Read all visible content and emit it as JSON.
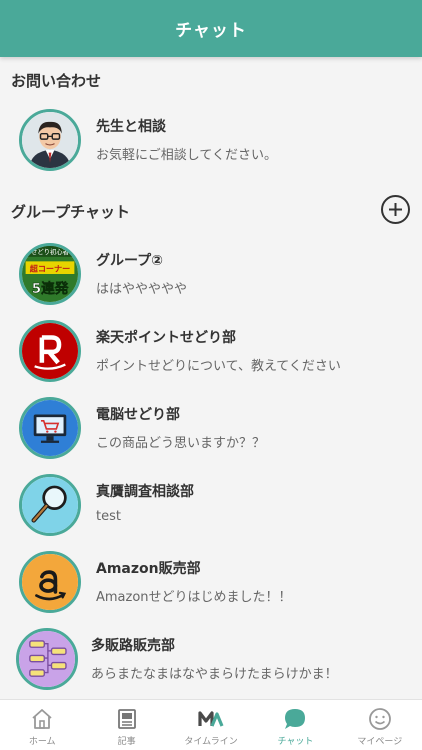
{
  "header": {
    "title": "チャット"
  },
  "inquiry": {
    "section_title": "お問い合わせ",
    "item": {
      "title": "先生と相談",
      "subtitle": "お気軽にご相談してください。"
    }
  },
  "groups": {
    "section_title": "グループチャット",
    "add_icon": "plus-circle-icon",
    "items": [
      {
        "title": "グループ②",
        "subtitle": "ははややややや",
        "avatar_text_top": "せどり初心者",
        "avatar_text_mid": "超コーナー",
        "avatar_text_bottom": "5連発"
      },
      {
        "title": "楽天ポイントせどり部",
        "subtitle": "ポイントせどりについて、教えてください"
      },
      {
        "title": "電脳せどり部",
        "subtitle": "この商品どう思いますか？？"
      },
      {
        "title": "真贋調査相談部",
        "subtitle": "test"
      },
      {
        "title": "Amazon販売部",
        "subtitle": "Amazonせどりはじめました！！"
      },
      {
        "title": "多販路販売部",
        "subtitle": "あらまたなまはなやまらけたまらけかま！"
      }
    ]
  },
  "tabbar": {
    "items": [
      {
        "label": "ホーム",
        "icon": "home-icon"
      },
      {
        "label": "記事",
        "icon": "article-icon"
      },
      {
        "label": "タイムライン",
        "icon": "timeline-icon"
      },
      {
        "label": "チャット",
        "icon": "chat-icon",
        "active": true
      },
      {
        "label": "マイページ",
        "icon": "mypage-icon"
      }
    ]
  },
  "colors": {
    "accent": "#4aa999",
    "rakuten": "#bf0000",
    "amazon": "#f3a73b"
  }
}
